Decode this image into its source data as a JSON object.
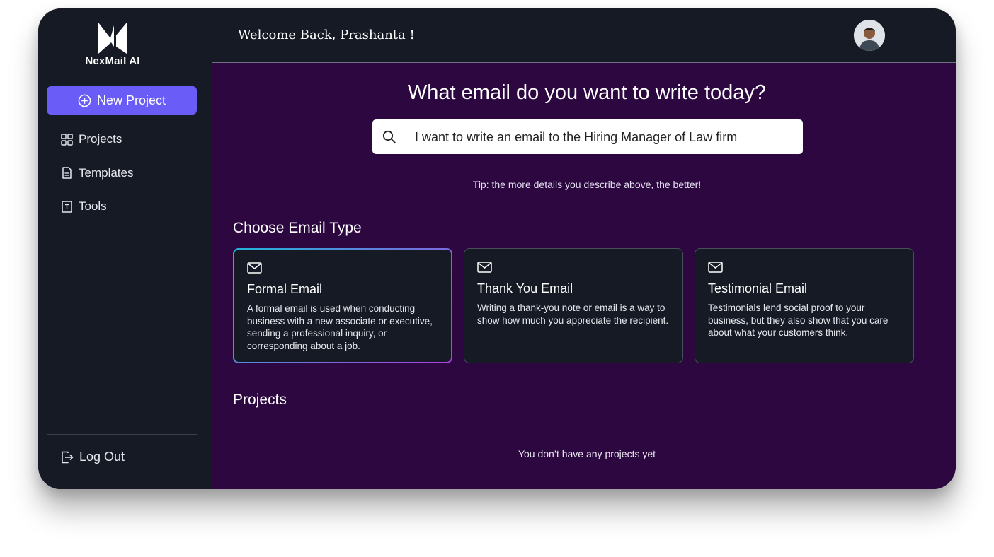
{
  "app": {
    "name": "NexMail AI"
  },
  "sidebar": {
    "new_project_label": "New Project",
    "items": [
      {
        "label": "Projects",
        "icon": "grid-icon"
      },
      {
        "label": "Templates",
        "icon": "document-icon"
      },
      {
        "label": "Tools",
        "icon": "tools-icon"
      }
    ],
    "logout_label": "Log Out"
  },
  "header": {
    "welcome": "Welcome Back, Prashanta !"
  },
  "main": {
    "headline": "What email do you want to write today?",
    "search": {
      "value": "I want to write an email to the Hiring Manager of Law firm"
    },
    "tip": "Tip: the more details you describe above, the better!",
    "email_types_title": "Choose Email Type",
    "email_types": [
      {
        "title": "Formal Email",
        "description": "A formal email is used when conducting business with a new associate or executive, sending a professional inquiry, or corresponding about a job.",
        "selected": true
      },
      {
        "title": "Thank You Email",
        "description": "Writing a thank-you note or email is a way to show how much you appreciate the recipient.",
        "selected": false
      },
      {
        "title": "Testimonial Email",
        "description": "Testimonials lend social proof to your business, but they also show that you care about what your customers think.",
        "selected": false
      }
    ],
    "projects_title": "Projects",
    "empty_projects": "You don’t have any projects yet"
  },
  "colors": {
    "sidebar_bg": "#161a25",
    "main_bg": "#2c0740",
    "accent": "#6a5cf6",
    "selected_border_start": "#1fb6d9",
    "selected_border_end": "#b13ee0"
  }
}
